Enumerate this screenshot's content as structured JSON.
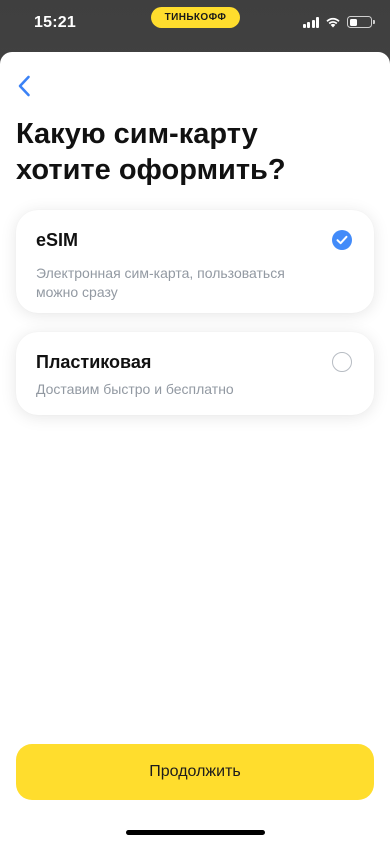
{
  "status_bar": {
    "time": "15:21",
    "brand": "ТИНЬКОФФ",
    "battery_level": 0.35
  },
  "header": {
    "back_icon": "chevron-left-icon",
    "title": "Какую сим-карту хотите оформить?"
  },
  "options": [
    {
      "title": "eSIM",
      "description": "Электронная сим-карта, пользоваться можно сразу",
      "selected": true
    },
    {
      "title": "Пластиковая",
      "description": "Доставим быстро и бесплатно",
      "selected": false
    }
  ],
  "footer": {
    "continue_label": "Продолжить"
  },
  "colors": {
    "accent_yellow": "#ffdd2d",
    "selected_blue": "#428bf9",
    "back_blue": "#3b82f6",
    "secondary_text": "#9299a2"
  }
}
